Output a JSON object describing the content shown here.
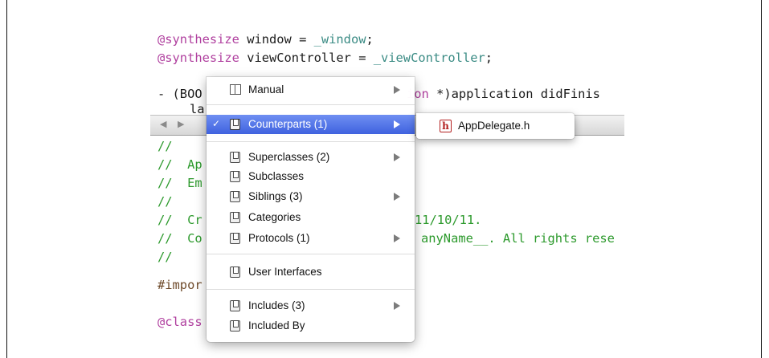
{
  "code": {
    "line1": {
      "kw": "@synthesize",
      "rest": " window = ",
      "ivar": "_window",
      "end": ";"
    },
    "line2": {
      "kw": "@synthesize",
      "rest": " viewController = ",
      "ivar": "_viewController",
      "end": ";"
    },
    "line3": {
      "start": "- (BOO",
      "end": "ion *)application didFinis"
    },
    "line4": {
      "text": "la"
    },
    "comment1": "//",
    "comment2": "//  Ap",
    "comment3": "//  Em",
    "comment4": "//",
    "comment5a": "//  Cr",
    "comment5b": "11/10/11.",
    "comment6a": "//  Co",
    "comment6b": "anyName__. All rights rese",
    "comment7": "//",
    "import": "#impor",
    "class": "@class"
  },
  "jumpbar": {
    "back_icon": "triangle-left",
    "forward_icon": "triangle-right",
    "back_glyph": "◀",
    "forward_glyph": "▶"
  },
  "menu": {
    "checkmark": "✓",
    "items": [
      {
        "label": "Manual",
        "icon": "manual-icon",
        "submenu": true
      },
      {
        "label": "Counterparts (1)",
        "icon": "file-icon",
        "submenu": true,
        "selected": true,
        "checked": true
      },
      {
        "label": "Superclasses (2)",
        "icon": "file-icon",
        "submenu": true
      },
      {
        "label": "Subclasses",
        "icon": "file-icon",
        "submenu": false
      },
      {
        "label": "Siblings (3)",
        "icon": "file-icon",
        "submenu": true
      },
      {
        "label": "Categories",
        "icon": "file-icon",
        "submenu": false
      },
      {
        "label": "Protocols (1)",
        "icon": "file-icon",
        "submenu": true
      },
      {
        "label": "User Interfaces",
        "icon": "file-icon",
        "submenu": false
      },
      {
        "label": "Includes (3)",
        "icon": "file-icon",
        "submenu": true
      },
      {
        "label": "Included By",
        "icon": "file-icon",
        "submenu": false
      }
    ]
  },
  "submenu": {
    "items": [
      {
        "label": "AppDelegate.h",
        "icon": "header-file-icon",
        "glyph": "h"
      }
    ]
  },
  "colors": {
    "keyword": "#b0409f",
    "ivar": "#3a8b84",
    "comment": "#2d9a2d",
    "selection": "#4a6ee6",
    "header_icon": "#b32020"
  }
}
